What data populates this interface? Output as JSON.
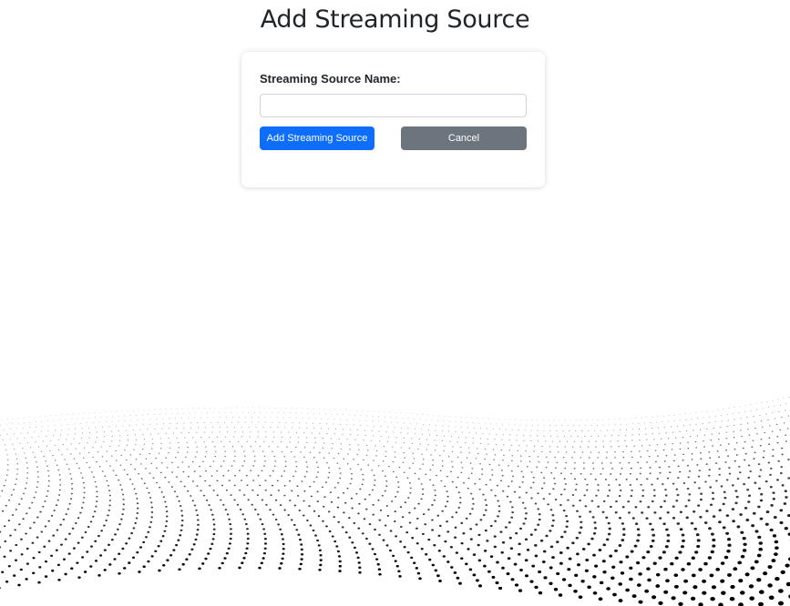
{
  "page": {
    "title": "Add Streaming Source"
  },
  "form": {
    "label": "Streaming Source Name:",
    "input_value": "",
    "input_placeholder": "",
    "submit_label": "Add Streaming Source",
    "cancel_label": "Cancel"
  },
  "colors": {
    "primary": "#0d6efd",
    "secondary": "#6c757d",
    "background": "#ffffff",
    "dots": "#000000"
  },
  "icons": {
    "background": "halftone-wave-pattern"
  }
}
